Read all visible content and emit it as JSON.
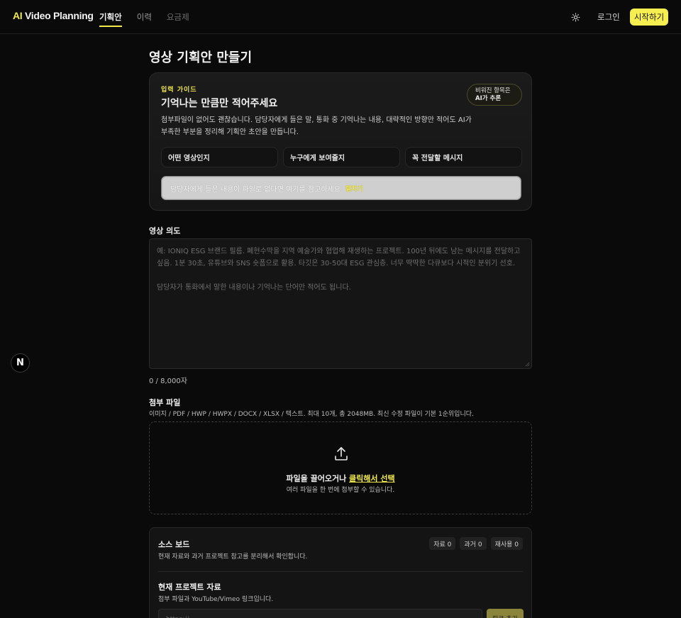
{
  "header": {
    "logo_ai": "AI",
    "logo_rest": " Video Planning",
    "nav": [
      {
        "label": "기획안"
      },
      {
        "label": "이력"
      },
      {
        "label": "요금제"
      }
    ],
    "theme_icon": "sun-icon",
    "login_label": "로그인",
    "start_label": "시작하기",
    "accent_color": "#f7ee4f"
  },
  "side": {
    "badge_letter": "N"
  },
  "page": {
    "title": "영상 기획안 만들기"
  },
  "guide": {
    "label": "입력 가이드",
    "title": "기억나는 만큼만 적어주세요",
    "badge_line1": "비워진 항목은",
    "badge_line2": "AI가 추론",
    "description": "첨부파일이 없어도 괜찮습니다. 담당자에게 들은 말, 통화 중 기억나는 내용, 대략적인 방향만 적어도 AI가 부족한 부분을 정리해 기획안 초안을 만듭니다.",
    "chips": [
      "어떤 영상인지",
      "누구에게 보여줄지",
      "꼭 전달할 메시지"
    ],
    "hint_text": "담당자에게 들은 내용이 파일로 없다면 여기를 참고하세요",
    "hint_action": "펼치기"
  },
  "intent": {
    "label": "영상 의도",
    "placeholder_line1": "예: IONIQ ESG 브랜드 필름. 폐현수막을 지역 예술가와 협업해 재생하는 프로젝트. 100년 뒤에도 남는 메시지를 전달하고 싶음. 1분 30초, 유튜브와 SNS 숏폼으로 활용. 타깃은 30-50대 ESG 관심층. 너무 딱딱한 다큐보다 시적인 분위기 선호.",
    "placeholder_line2": "담당자가 통화에서 말한 내용이나 기억나는 단어만 적어도 됩니다.",
    "char_count": "0 / 8,000자"
  },
  "attachments": {
    "label": "첨부 파일",
    "description": "이미지 / PDF / HWP / HWPX / DOCX / XLSX / 텍스트. 최대 10개, 총 2048MB. 최신 수정 파일이 기본 1순위입니다.",
    "drop_main": "파일을 끌어오거나 ",
    "drop_link": "클릭해서 선택",
    "drop_sub": "여러 파일을 한 번에 첨부할 수 있습니다.",
    "icon": "upload-icon"
  },
  "source_board": {
    "title": "소스 보드",
    "description": "현재 자료와 과거 프로젝트 참고를 분리해서 확인합니다.",
    "counts": [
      "자료 0",
      "과거 0",
      "재사용 0"
    ],
    "current_title": "현재 프로젝트 자료",
    "current_desc": "첨부 파일과 YouTube/Vimeo 링크입니다.",
    "link_placeholder": "https://...",
    "add_label": "링크 추가"
  }
}
